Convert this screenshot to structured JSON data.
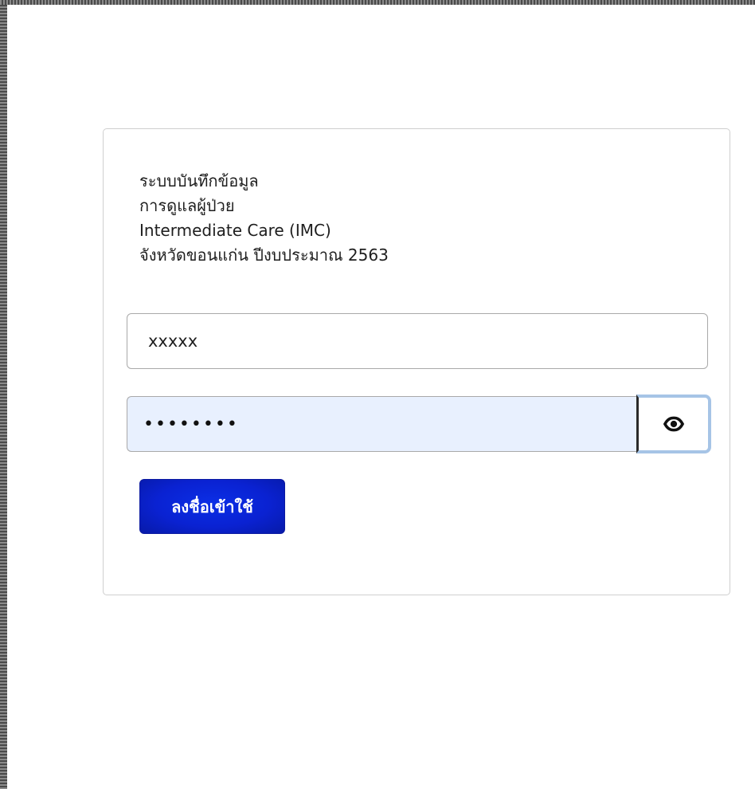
{
  "form": {
    "title_lines": [
      "ระบบบันทึกข้อมูล",
      "การดูแลผู้ป่วย",
      "Intermediate Care (IMC)",
      "จังหวัดขอนแก่น ปีงบประมาณ 2563"
    ],
    "username_value": "xxxxx",
    "password_masked": "••••••••",
    "toggle_icon": "eye-icon",
    "submit_label": "ลงชื่อเข้าใช้"
  },
  "colors": {
    "submit_bg": "#0a22d2",
    "password_bg": "#e8f0fe",
    "focus_ring": "#a6c4e6"
  }
}
